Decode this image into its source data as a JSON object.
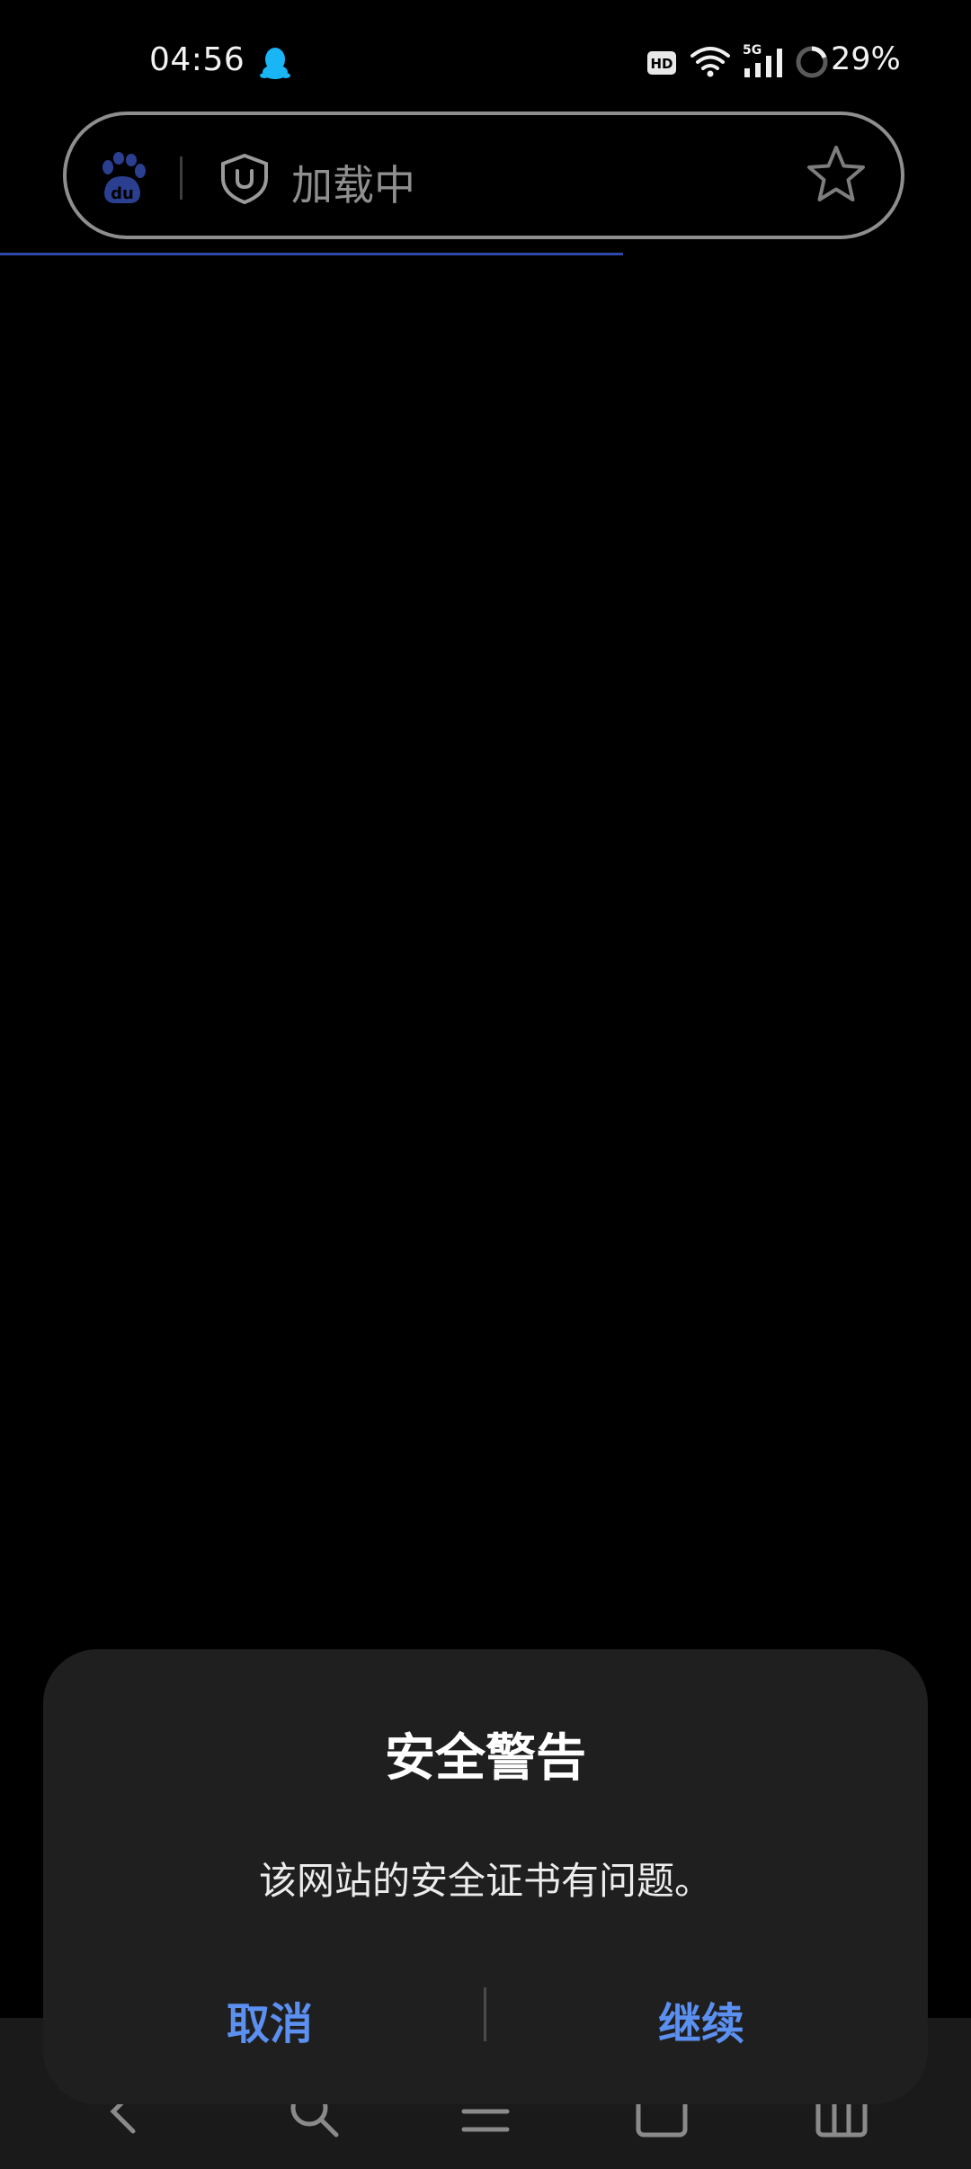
{
  "status_bar": {
    "time": "04:56",
    "battery_percent": "29%",
    "icons": [
      "qq-icon",
      "hd-icon",
      "wifi-icon",
      "cellular-5g-icon",
      "battery-icon"
    ]
  },
  "address_bar": {
    "text": "加载中",
    "icons": [
      "baidu-logo-icon",
      "shield-icon",
      "star-icon"
    ]
  },
  "dialog": {
    "title": "安全警告",
    "message": "该网站的安全证书有问题。",
    "cancel_label": "取消",
    "continue_label": "继续"
  },
  "bottom_nav": {
    "icons": [
      "back-icon",
      "search-icon",
      "menu-icon",
      "tabs-icon",
      "home-icon"
    ]
  },
  "colors": {
    "background": "#000000",
    "dialog_bg": "#1f1f1f",
    "accent": "#5b8ff0",
    "progress": "#2f49a8"
  }
}
